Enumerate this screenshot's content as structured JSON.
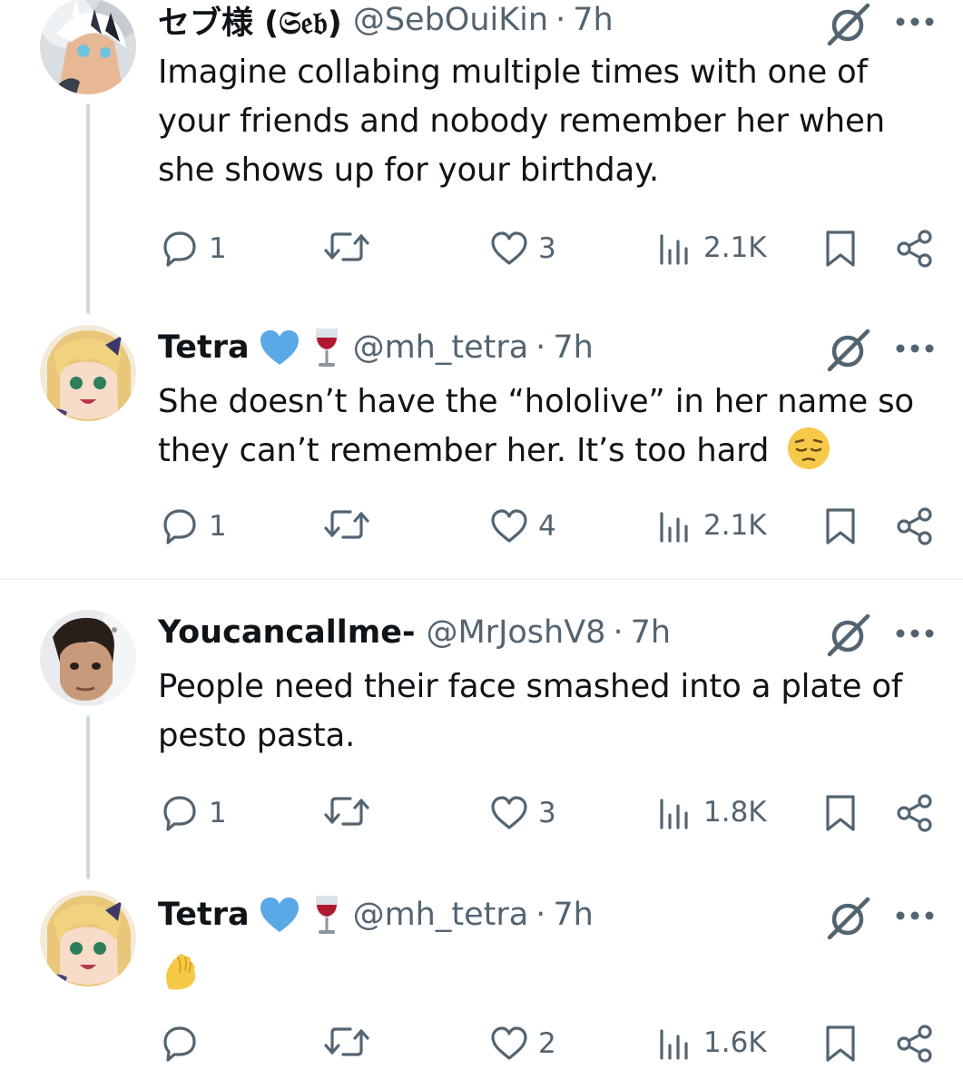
{
  "tweets": [
    {
      "name": "セブ様 (𝔖𝔢𝔟)",
      "handle": "@SebOuiKin",
      "sep": "·",
      "time": "7h",
      "text": "Imagine collabing multiple times with one of your friends and nobody remember her when she shows up for your birthday.",
      "replies": "1",
      "reposts": "",
      "likes": "3",
      "views": "2.1K"
    },
    {
      "name": "Tetra",
      "handle": "@mh_tetra",
      "sep": "·",
      "time": "7h",
      "text": "She doesn’t have the “hololive” in her name so they can’t remember her. It’s too hard",
      "replies": "1",
      "reposts": "",
      "likes": "4",
      "views": "2.1K"
    },
    {
      "name": "Youcancallme-",
      "handle": "@MrJoshV8",
      "sep": "·",
      "time": "7h",
      "text": "People need their face smashed into a plate of pesto pasta.",
      "replies": "1",
      "reposts": "",
      "likes": "3",
      "views": "1.8K"
    },
    {
      "name": "Tetra",
      "handle": "@mh_tetra",
      "sep": "·",
      "time": "7h",
      "text": "",
      "replies": "",
      "reposts": "",
      "likes": "2",
      "views": "1.6K"
    }
  ],
  "icons": {
    "reply": "reply-icon",
    "repost": "repost-icon",
    "like": "like-icon",
    "views": "views-icon",
    "bookmark": "bookmark-icon",
    "share": "share-icon",
    "grok": "grok-icon",
    "more": "more-icon",
    "verified": "blue-heart-icon",
    "wine": "wine-glass-icon",
    "pensive": "pensive-face-emoji",
    "pinch": "pinched-fingers-emoji"
  },
  "colors": {
    "text": "#0f1419",
    "secondary": "#536471",
    "thread_line": "#cfd9de",
    "divider": "#eff3f4",
    "heart": "#5aa9e6"
  }
}
